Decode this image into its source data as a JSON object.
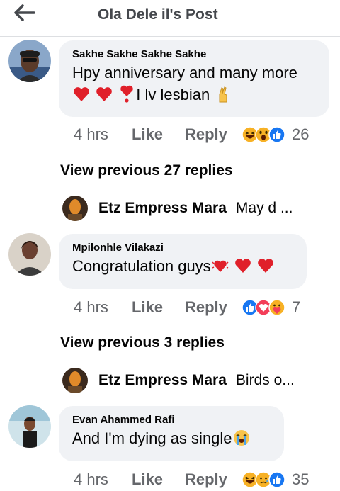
{
  "header": {
    "title": "Ola Dele il's Post",
    "back_icon": "arrow-left-icon"
  },
  "comments": [
    {
      "author": "Sakhe Sakhe Sakhe Sakhe",
      "line1": "Hpy anniversary and many more",
      "line2_text": "I lv lesbian",
      "time": "4 hrs",
      "like": "Like",
      "reply": "Reply",
      "reaction_count": "26",
      "reactions": [
        "haha",
        "wow",
        "like"
      ]
    },
    {
      "author": "Mpilonhle Vilakazi",
      "text": "Congratulation guys",
      "time": "4 hrs",
      "like": "Like",
      "reply": "Reply",
      "reaction_count": "7",
      "reactions": [
        "like",
        "love",
        "care"
      ]
    },
    {
      "author": "Evan Ahammed Rafi",
      "text": "And I'm dying as single",
      "time": "4 hrs",
      "like": "Like",
      "reply": "Reply",
      "reaction_count": "35",
      "reactions": [
        "haha",
        "sad",
        "like"
      ]
    }
  ],
  "threads": [
    {
      "view_previous": "View previous 27 replies",
      "reply_author": "Etz Empress Mara",
      "reply_preview": "May d ..."
    },
    {
      "view_previous": "View previous 3 replies",
      "reply_author": "Etz Empress Mara",
      "reply_preview": "Birds o..."
    }
  ],
  "colors": {
    "bubble": "#f0f2f5",
    "meta_text": "#65676b",
    "like_blue": "#1877f2",
    "love_red": "#f33e58",
    "haha_yellow": "#f7b125"
  }
}
